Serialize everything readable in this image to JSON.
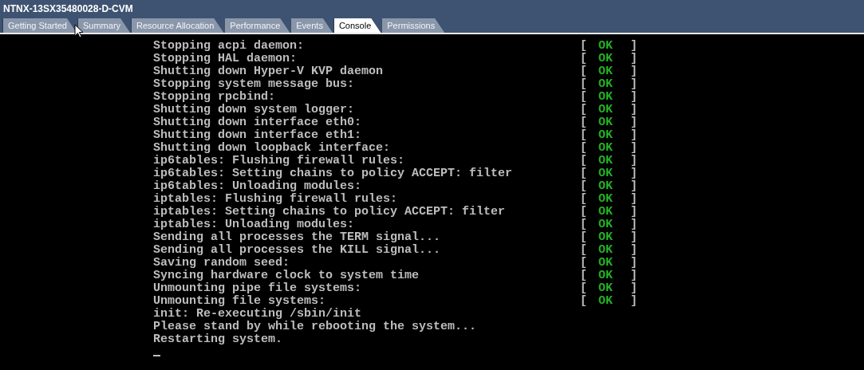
{
  "window": {
    "title": "NTNX-13SX35480028-D-CVM"
  },
  "tabs": [
    {
      "label": "Getting Started",
      "selected": false
    },
    {
      "label": "Summary",
      "selected": false
    },
    {
      "label": "Resource Allocation",
      "selected": false
    },
    {
      "label": "Performance",
      "selected": false
    },
    {
      "label": "Events",
      "selected": false
    },
    {
      "label": "Console",
      "selected": true
    },
    {
      "label": "Permissions",
      "selected": false
    }
  ],
  "console": {
    "lines": [
      {
        "text": "Stopping acpi daemon:",
        "status": {
          "open": "[",
          "label": "OK",
          "close": "]"
        }
      },
      {
        "text": "Stopping HAL daemon:",
        "status": {
          "open": "[",
          "label": "OK",
          "close": "]"
        }
      },
      {
        "text": "Shutting down Hyper-V KVP daemon",
        "status": {
          "open": "[",
          "label": "OK",
          "close": "]"
        }
      },
      {
        "text": "Stopping system message bus:",
        "status": {
          "open": "[",
          "label": "OK",
          "close": "]"
        }
      },
      {
        "text": "Stopping rpcbind:",
        "status": {
          "open": "[",
          "label": "OK",
          "close": "]"
        }
      },
      {
        "text": "Shutting down system logger:",
        "status": {
          "open": "[",
          "label": "OK",
          "close": "]"
        }
      },
      {
        "text": "Shutting down interface eth0:",
        "status": {
          "open": "[",
          "label": "OK",
          "close": "]"
        }
      },
      {
        "text": "Shutting down interface eth1:",
        "status": {
          "open": "[",
          "label": "OK",
          "close": "]"
        }
      },
      {
        "text": "Shutting down loopback interface:",
        "status": {
          "open": "[",
          "label": "OK",
          "close": "]"
        }
      },
      {
        "text": "ip6tables: Flushing firewall rules:",
        "status": {
          "open": "[",
          "label": "OK",
          "close": "]"
        }
      },
      {
        "text": "ip6tables: Setting chains to policy ACCEPT: filter",
        "status": {
          "open": "[",
          "label": "OK",
          "close": "]"
        }
      },
      {
        "text": "ip6tables: Unloading modules:",
        "status": {
          "open": "[",
          "label": "OK",
          "close": "]"
        }
      },
      {
        "text": "iptables: Flushing firewall rules:",
        "status": {
          "open": "[",
          "label": "OK",
          "close": "]"
        }
      },
      {
        "text": "iptables: Setting chains to policy ACCEPT: filter",
        "status": {
          "open": "[",
          "label": "OK",
          "close": "]"
        }
      },
      {
        "text": "iptables: Unloading modules:",
        "status": {
          "open": "[",
          "label": "OK",
          "close": "]"
        }
      },
      {
        "text": "Sending all processes the TERM signal...",
        "status": {
          "open": "[",
          "label": "OK",
          "close": "]"
        }
      },
      {
        "text": "Sending all processes the KILL signal...",
        "status": {
          "open": "[",
          "label": "OK",
          "close": "]"
        }
      },
      {
        "text": "Saving random seed:",
        "status": {
          "open": "[",
          "label": "OK",
          "close": "]"
        }
      },
      {
        "text": "Syncing hardware clock to system time",
        "status": {
          "open": "[",
          "label": "OK",
          "close": "]"
        }
      },
      {
        "text": "Unmounting pipe file systems:",
        "status": {
          "open": "[",
          "label": "OK",
          "close": "]"
        }
      },
      {
        "text": "Unmounting file systems:",
        "status": {
          "open": "[",
          "label": "OK",
          "close": "]"
        }
      },
      {
        "text": "init: Re-executing /sbin/init"
      },
      {
        "text": "Please stand by while rebooting the system..."
      },
      {
        "text": "Restarting system."
      }
    ]
  }
}
